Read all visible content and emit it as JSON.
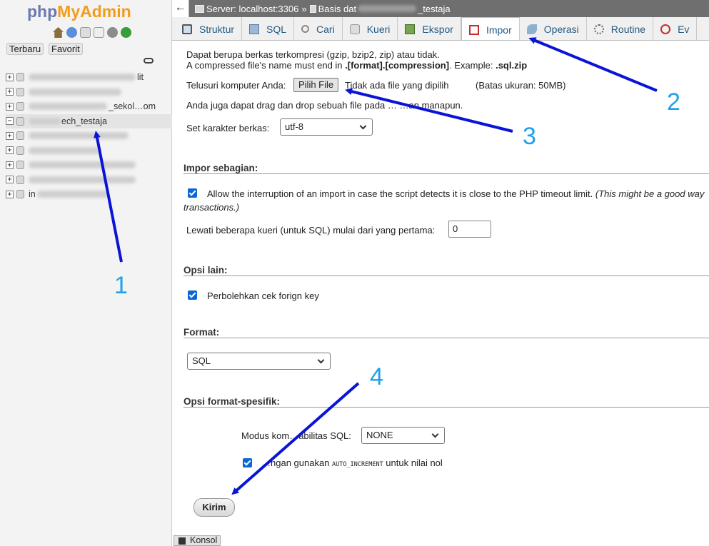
{
  "app": {
    "logo_php": "php",
    "logo_my": "My",
    "logo_admin": "Admin"
  },
  "nav": {
    "recent_label": "Terbaru",
    "favorite_label": "Favorit",
    "databases": [
      {
        "label": "",
        "suffix": "lit",
        "selected": false,
        "expander": "+"
      },
      {
        "label": "",
        "suffix": "",
        "selected": false,
        "expander": "+"
      },
      {
        "label": "",
        "suffix": "_sekol…om",
        "selected": false,
        "expander": "+"
      },
      {
        "label": "ech_testaja",
        "suffix": "",
        "selected": true,
        "expander": "−"
      },
      {
        "label": "",
        "suffix": "",
        "selected": false,
        "expander": "+"
      },
      {
        "label": "",
        "suffix": "",
        "selected": false,
        "expander": "+"
      },
      {
        "label": "",
        "suffix": "",
        "selected": false,
        "expander": "+"
      },
      {
        "label": "",
        "suffix": "",
        "selected": false,
        "expander": "+"
      },
      {
        "label": "in",
        "suffix": "",
        "selected": false,
        "expander": "+"
      }
    ]
  },
  "breadcrumb": {
    "server": "Server: localhost:3306",
    "separator": "»",
    "database_prefix": "Basis dat",
    "database_suffix": "_testaja"
  },
  "tabs": [
    {
      "label": "Struktur",
      "icon": "struct",
      "active": false
    },
    {
      "label": "SQL",
      "icon": "sql",
      "active": false
    },
    {
      "label": "Cari",
      "icon": "search",
      "active": false
    },
    {
      "label": "Kueri",
      "icon": "query",
      "active": false
    },
    {
      "label": "Ekspor",
      "icon": "export",
      "active": false
    },
    {
      "label": "Impor",
      "icon": "import",
      "active": true
    },
    {
      "label": "Operasi",
      "icon": "ops",
      "active": false
    },
    {
      "label": "Routine",
      "icon": "routine",
      "active": false
    },
    {
      "label": "Ev",
      "icon": "event",
      "active": false
    }
  ],
  "file_section": {
    "compress_note": "Dapat berupa berkas terkompresi (gzip, bzip2, zip) atau tidak.",
    "name_note_prefix": "A compressed file's name must end in ",
    "name_note_format": ".[format].[compression]",
    "name_note_middle": ". Example: ",
    "name_note_example": ".sql.zip",
    "browse_label": "Telusuri komputer Anda:",
    "choose_file_button": "Pilih File",
    "no_file_text": "Tidak ada file yang dipilih",
    "max_size": "(Batas ukuran: 50MB)",
    "drag_drop_note": "Anda juga dapat drag dan drop sebuah file pada … …an manapun.",
    "charset_label": "Set karakter berkas:",
    "charset_value": "utf-8"
  },
  "partial_import": {
    "title": "Impor sebagian:",
    "allow_interrupt_label": "Allow the interruption of an import in case the script detects it is close to the PHP timeout limit.",
    "allow_interrupt_hint": "(This might be a good way",
    "allow_interrupt_hint_cont": "transactions.)",
    "allow_interrupt_checked": true,
    "skip_queries_label": "Lewati beberapa kueri (untuk SQL) mulai dari yang pertama:",
    "skip_queries_value": "0"
  },
  "other_options": {
    "title": "Opsi lain:",
    "foreign_key_label": "Perbolehkan cek forign key",
    "foreign_key_checked": true
  },
  "format": {
    "title": "Format:",
    "value": "SQL"
  },
  "format_specific": {
    "title": "Opsi format-spesifik:",
    "compat_label": "Modus kom…abilitas SQL:",
    "compat_value": "NONE",
    "auto_increment_prefix": "…ngan gunakan ",
    "auto_increment_code": "AUTO_INCREMENT",
    "auto_increment_suffix": " untuk nilai nol",
    "auto_increment_checked": true
  },
  "submit_label": "Kirim",
  "console_label": "Konsol",
  "annotations": {
    "colors": {
      "arrow": "#0a14d6",
      "number": "#1ea1e8"
    },
    "labels": [
      "1",
      "2",
      "3",
      "4"
    ]
  }
}
